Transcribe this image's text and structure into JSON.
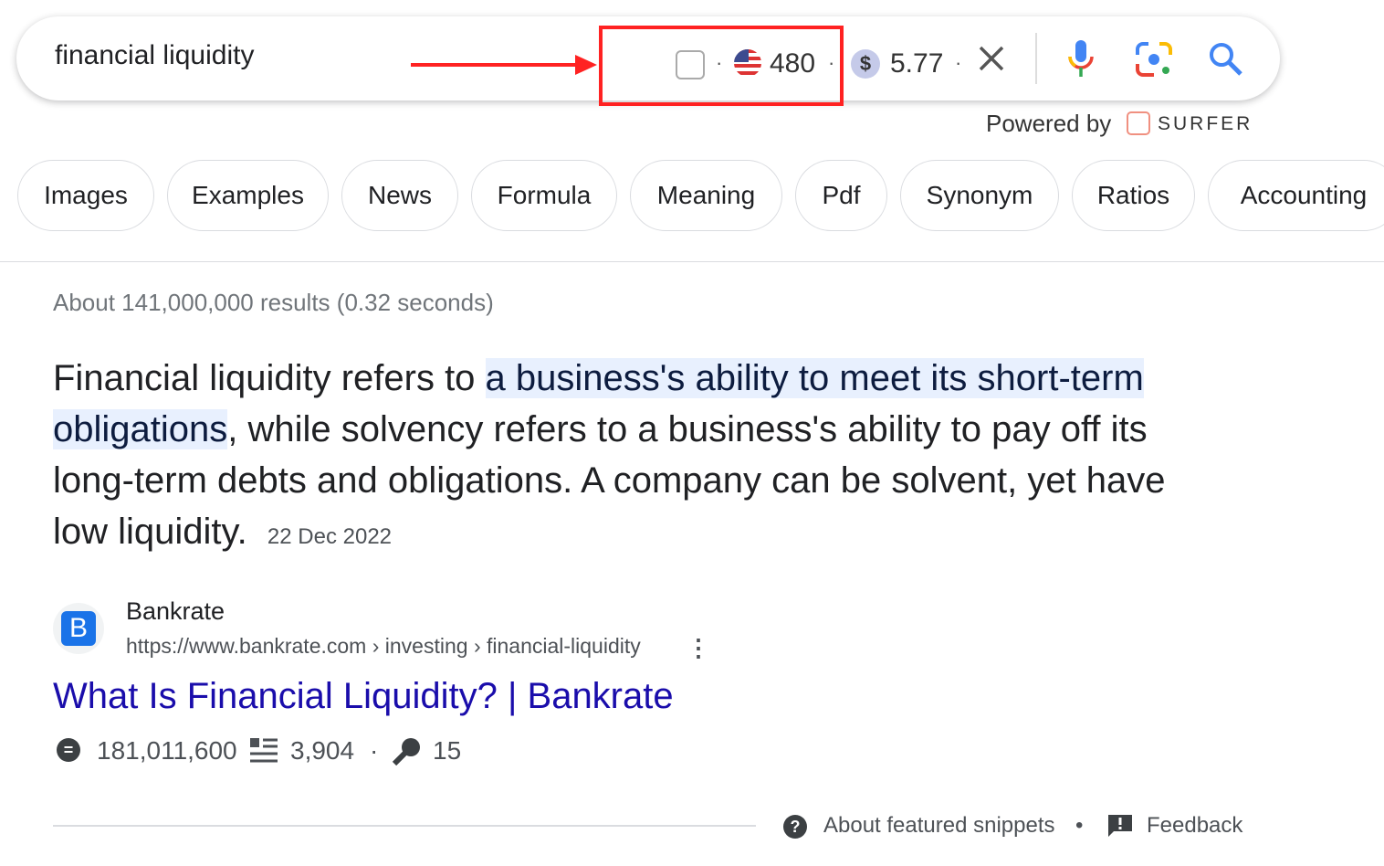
{
  "search": {
    "query": "financial liquidity",
    "volume": "480",
    "cpc": "5.77",
    "separator": "·",
    "country_icon": "us-flag-icon",
    "powered_by": "Powered by",
    "brand": "SURFER"
  },
  "colors": {
    "highlight_box": "#ff2a1a",
    "link": "#1a0dab",
    "snippet_highlight": "#e8f0fe"
  },
  "chips": [
    "Images",
    "Examples",
    "News",
    "Formula",
    "Meaning",
    "Pdf",
    "Synonym",
    "Ratios",
    "Accounting"
  ],
  "result_stats": "About 141,000,000 results (0.32 seconds)",
  "snippet": {
    "before": "Financial liquidity refers to ",
    "highlight_1": "a business's ability to meet its short-term",
    "highlight_2": "obligations",
    "after": ", while solvency refers to a business's ability to pay off its long-term debts and obligations. A company can be solvent, yet have low liquidity.",
    "date": "22 Dec 2022"
  },
  "result": {
    "favicon_letter": "B",
    "site": "Bankrate",
    "url": "https://www.bankrate.com › investing › financial-liquidity",
    "title": "What Is Financial Liquidity? | Bankrate",
    "traffic": "181,011,600",
    "words": "3,904",
    "keywords": "15",
    "more": "⋮"
  },
  "footer": {
    "about": "About featured snippets",
    "bullet": "•",
    "feedback": "Feedback"
  }
}
